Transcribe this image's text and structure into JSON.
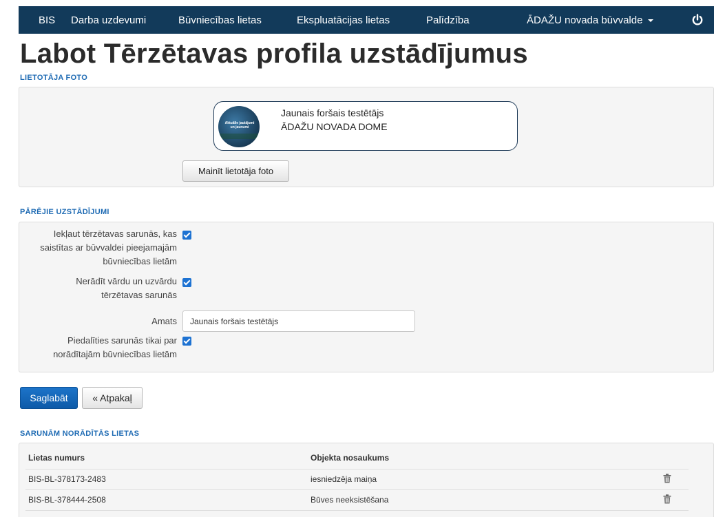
{
  "nav": {
    "items": [
      "BIS",
      "Darba uzdevumi",
      "Būvniecības lietas",
      "Ekspluatācijas lietas",
      "Palīdzība"
    ],
    "org_dropdown": "ĀDAŽU novada būvvalde",
    "logout_icon": "power-icon"
  },
  "page": {
    "title": "Labot Tērzētavas profila uzstādījumus"
  },
  "photo_section": {
    "label": "LIETOTĀJA FOTO",
    "avatar_text": "Aktuālie jautājumi un jaunumi",
    "name": "Jaunais foršais testētājs",
    "organization": "ĀDAŽU NOVADA DOME",
    "change_button": "Mainīt lietotāja foto"
  },
  "settings_section": {
    "label": "PĀRĒJIE UZSTĀDĪJUMI",
    "include_chats": {
      "lines": [
        "Iekļaut tērzētavas sarunās, kas",
        "saistītas ar būvvaldei pieejamajām",
        "būvniecības lietām"
      ],
      "checked": true
    },
    "hide_name": {
      "lines": [
        "Nerādīt vārdu un uzvārdu",
        "tērzētavas sarunās"
      ],
      "checked": true
    },
    "position": {
      "label": "Amats",
      "value": "Jaunais foršais testētājs"
    },
    "only_assigned": {
      "lines": [
        "Piedalīties sarunās tikai par",
        "norādītajām būvniecības lietām"
      ],
      "checked": true
    }
  },
  "actions": {
    "save": "Saglabāt",
    "back": "« Atpakaļ"
  },
  "cases_section": {
    "label": "SARUNĀM NORĀDĪTĀS LIETAS",
    "columns": [
      "Lietas numurs",
      "Objekta nosaukums"
    ],
    "rows": [
      {
        "number": "BIS-BL-378173-2483",
        "object": "iesniedzēja maiņa"
      },
      {
        "number": "BIS-BL-378444-2508",
        "object": "Būves neeksistēšana"
      }
    ]
  },
  "colors": {
    "navbar": "#123a5a",
    "accent": "#1d6ab3",
    "primary_button": "#0d5aa8",
    "checkbox": "#1d72d2"
  }
}
